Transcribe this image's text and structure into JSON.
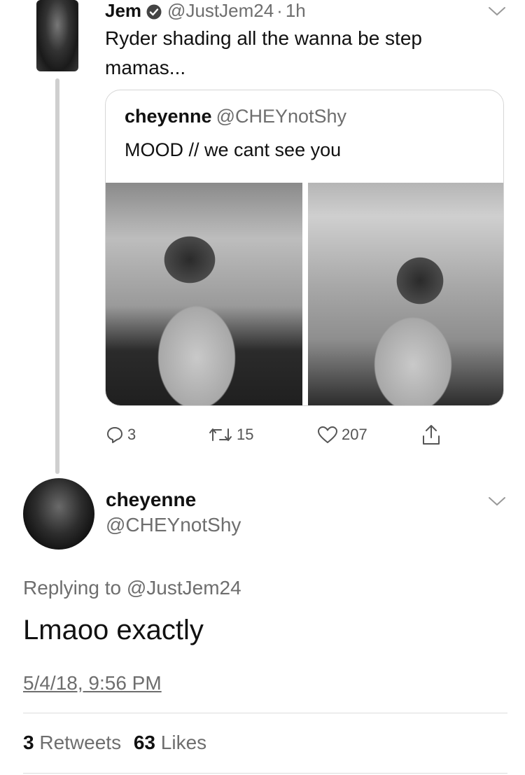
{
  "colors": {
    "text": "#111111",
    "secondary": "#6e6e6e",
    "border": "#d6d6d6",
    "thread_line": "#cfcfcf"
  },
  "tweet": {
    "name": "Jem",
    "handle": "@JustJem24",
    "separator": "·",
    "time": "1h",
    "text": "Ryder shading all the wanna be step mamas...",
    "quote": {
      "name": "cheyenne",
      "handle": "@CHEYnotShy",
      "text": "MOOD // we cant see you"
    },
    "actions": {
      "replies": "3",
      "retweets": "15",
      "likes": "207"
    }
  },
  "reply": {
    "name": "cheyenne",
    "handle": "@CHEYnotShy",
    "replying_prefix": "Replying to",
    "replying_handle": "@JustJem24",
    "text": "Lmaoo exactly",
    "timestamp": "5/4/18, 9:56 PM",
    "retweet_count": "3",
    "retweet_label": "Retweets",
    "like_count": "63",
    "like_label": "Likes"
  },
  "icons": [
    "verified-badge-icon",
    "chevron-down-icon",
    "reply-icon",
    "retweet-icon",
    "like-icon",
    "share-icon"
  ]
}
